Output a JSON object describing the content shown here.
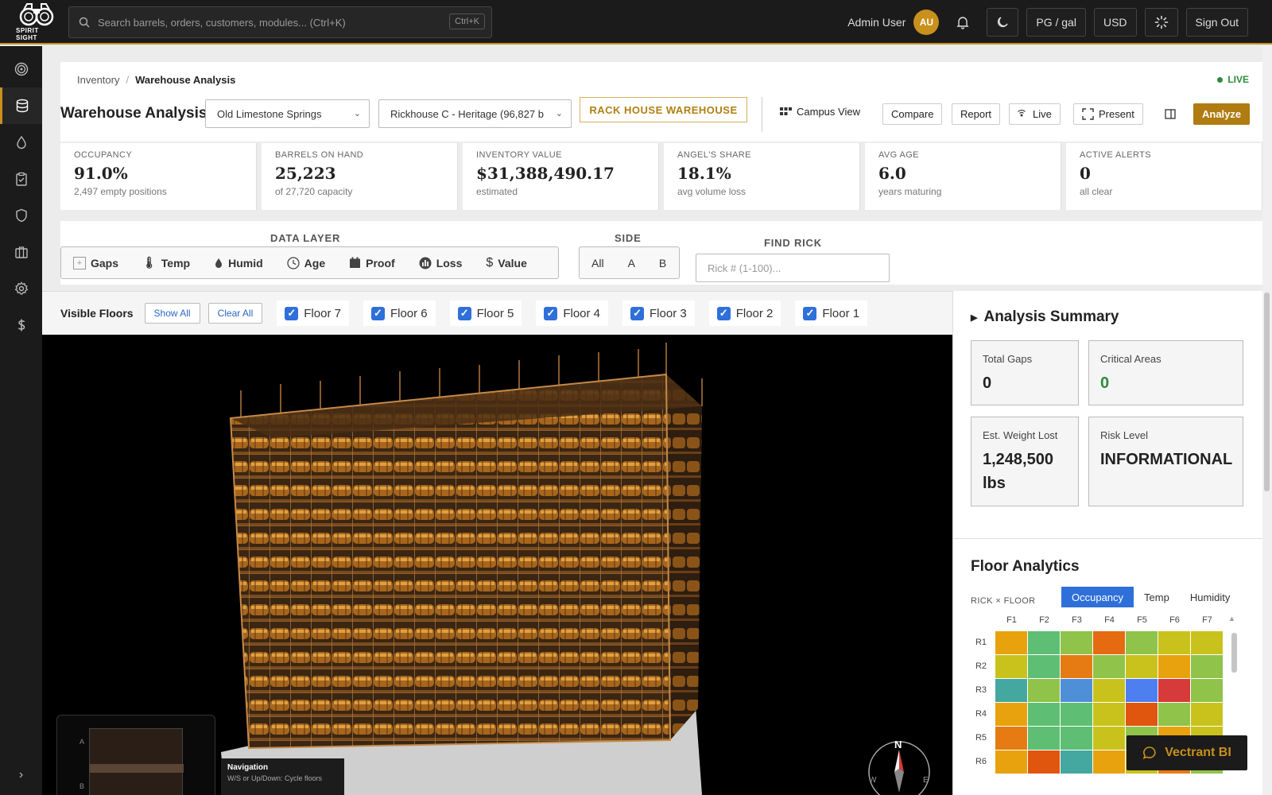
{
  "app": {
    "logo_text": "SPIRIT SIGHT"
  },
  "search": {
    "placeholder": "Search barrels, orders, customers, modules... (Ctrl+K)",
    "shortcut": "Ctrl+K"
  },
  "topbar": {
    "user": "Admin User",
    "initials": "AU",
    "units": "PG / gal",
    "currency": "USD",
    "signout": "Sign Out"
  },
  "breadcrumb": {
    "parent": "Inventory",
    "sep": "/",
    "current": "Warehouse Analysis"
  },
  "status": {
    "live": "LIVE"
  },
  "header": {
    "title": "Warehouse Analysis",
    "site_select": "Old Limestone Springs",
    "house_select": "Rickhouse C - Heritage (96,827 b",
    "rack_btn": "RACK HOUSE WAREHOUSE",
    "campus": "Campus View",
    "compare": "Compare",
    "report": "Report",
    "live": "Live",
    "present": "Present",
    "analyze": "Analyze"
  },
  "kpis": [
    {
      "label": "OCCUPANCY",
      "value": "91.0%",
      "sub": "2,497 empty positions"
    },
    {
      "label": "BARRELS ON HAND",
      "value": "25,223",
      "sub": "of 27,720 capacity"
    },
    {
      "label": "INVENTORY VALUE",
      "value": "$31,388,490.17",
      "sub": "estimated"
    },
    {
      "label": "ANGEL'S SHARE",
      "value": "18.1%",
      "sub": "avg volume loss"
    },
    {
      "label": "AVG AGE",
      "value": "6.0",
      "sub": "years maturing"
    },
    {
      "label": "ACTIVE ALERTS",
      "value": "0",
      "sub": "all clear"
    }
  ],
  "layers": {
    "label": "DATA LAYER",
    "items": [
      "Gaps",
      "Temp",
      "Humid",
      "Age",
      "Proof",
      "Loss",
      "Value"
    ],
    "side_label": "SIDE",
    "sides": [
      "All",
      "A",
      "B"
    ],
    "find_label": "FIND RICK",
    "find_placeholder": "Rick # (1-100)..."
  },
  "floors": {
    "label": "Visible Floors",
    "show_all": "Show All",
    "clear_all": "Clear All",
    "items": [
      "Floor 7",
      "Floor 6",
      "Floor 5",
      "Floor 4",
      "Floor 3",
      "Floor 2",
      "Floor 1"
    ]
  },
  "viewer": {
    "minimap_a": "A",
    "minimap_b": "B",
    "nav_title": "Navigation",
    "nav_hint": "W/S or Up/Down: Cycle floors",
    "compass": {
      "n": "N",
      "w": "W",
      "e": "E"
    }
  },
  "summary": {
    "title": "Analysis Summary",
    "cards": [
      {
        "label": "Total Gaps",
        "value": "0"
      },
      {
        "label": "Critical Areas",
        "value": "0"
      },
      {
        "label": "Est. Weight Lost",
        "value": "1,248,500 lbs"
      },
      {
        "label": "Risk Level",
        "value": "INFORMATIONAL"
      }
    ]
  },
  "floor_analytics": {
    "title": "Floor Analytics",
    "subtitle": "RICK × FLOOR",
    "tabs": [
      "Occupancy",
      "Temp",
      "Humidity"
    ],
    "columns": [
      "F1",
      "F2",
      "F3",
      "F4",
      "F5",
      "F6",
      "F7"
    ],
    "rows": [
      "R1",
      "R2",
      "R3",
      "R4",
      "R5",
      "R6"
    ],
    "cells": [
      [
        "#e8a20d",
        "#5ebf74",
        "#8fc34a",
        "#e56a12",
        "#8fc34a",
        "#c9c21c",
        "#c9c21c"
      ],
      [
        "#c9c21c",
        "#5ebf74",
        "#e57b12",
        "#8fc34a",
        "#c9c21c",
        "#e8a20d",
        "#8fc34a"
      ],
      [
        "#44a8a0",
        "#8fc34a",
        "#4f8fd8",
        "#c9c21c",
        "#4d7ff0",
        "#d73a3a",
        "#8fc34a"
      ],
      [
        "#e8a20d",
        "#5ebf74",
        "#5ebf74",
        "#c9c21c",
        "#e0560f",
        "#8fc34a",
        "#c9c21c"
      ],
      [
        "#e57b12",
        "#5ebf74",
        "#5ebf74",
        "#c9c21c",
        "#8fc34a",
        "#e8a20d",
        "#c9c21c"
      ],
      [
        "#e8a20d",
        "#e0560f",
        "#44a8a0",
        "#e8a20d",
        "#c9c21c",
        "#e57b12",
        "#8fc34a"
      ]
    ]
  },
  "chat": {
    "label": "Vectrant BI"
  },
  "colors": {
    "accent": "#c8901c",
    "primary": "#2f6fd9",
    "dark": "#1b1b1b",
    "live": "#2e8b3c",
    "critical_value": "#2e8b3c"
  }
}
